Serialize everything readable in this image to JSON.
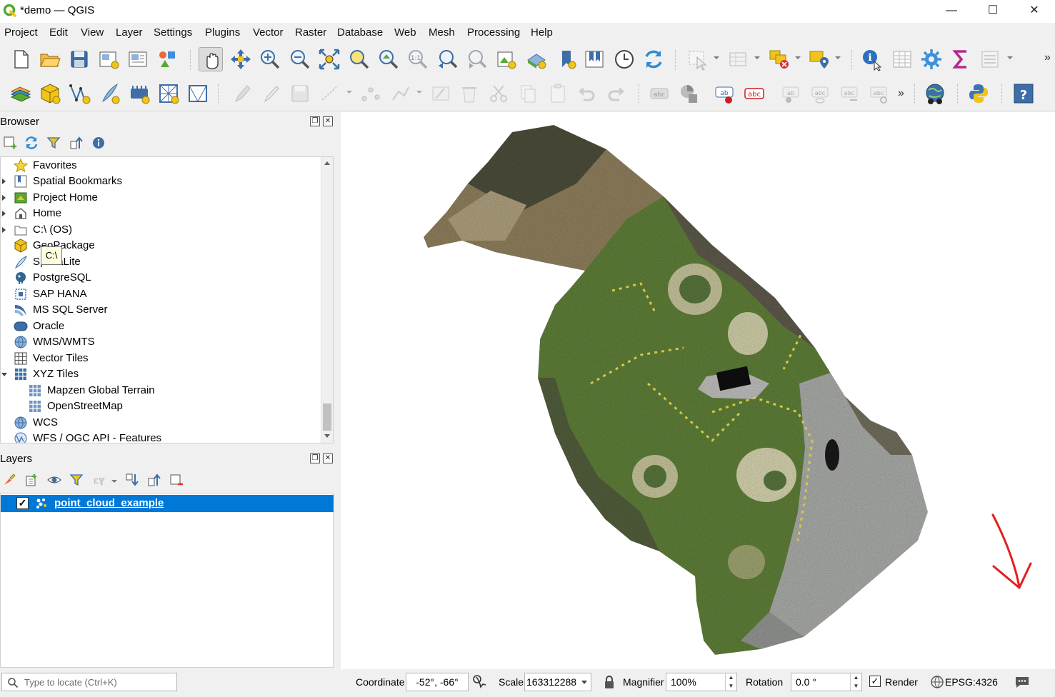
{
  "window": {
    "title": "*demo — QGIS",
    "minimize": "—",
    "maximize": "☐",
    "close": "✕"
  },
  "menu": [
    "Project",
    "Edit",
    "View",
    "Layer",
    "Settings",
    "Plugins",
    "Vector",
    "Raster",
    "Database",
    "Web",
    "Mesh",
    "Processing",
    "Help"
  ],
  "toolbar": {
    "overflow": "»"
  },
  "browser": {
    "title": "Browser",
    "float_btn": "❐",
    "close_btn": "✕",
    "items": [
      {
        "label": "Favorites",
        "icon": "star-icon"
      },
      {
        "label": "Spatial Bookmarks",
        "icon": "bookmark-icon"
      },
      {
        "label": "Project Home",
        "icon": "project-home-icon"
      },
      {
        "label": "Home",
        "icon": "home-icon"
      },
      {
        "label": "C:\\ (OS)",
        "icon": "drive-folder-icon"
      },
      {
        "label": "GeoPackage",
        "icon": "geopackage-icon"
      },
      {
        "label": "SpatiaLite",
        "icon": "spatialite-icon"
      },
      {
        "label": "PostgreSQL",
        "icon": "postgresql-icon"
      },
      {
        "label": "SAP HANA",
        "icon": "sap-hana-icon"
      },
      {
        "label": "MS SQL Server",
        "icon": "mssql-icon"
      },
      {
        "label": "Oracle",
        "icon": "oracle-icon"
      },
      {
        "label": "WMS/WMTS",
        "icon": "wms-icon"
      },
      {
        "label": "Vector Tiles",
        "icon": "vector-tiles-icon"
      },
      {
        "label": "XYZ Tiles",
        "icon": "xyz-tiles-icon"
      },
      {
        "label": "Mapzen Global Terrain",
        "icon": "xyz-tile-icon"
      },
      {
        "label": "OpenStreetMap",
        "icon": "xyz-tile-icon"
      },
      {
        "label": "WCS",
        "icon": "wcs-icon"
      },
      {
        "label": "WFS / OGC API - Features",
        "icon": "wfs-icon"
      }
    ],
    "tooltip": "C:\\"
  },
  "layers": {
    "title": "Layers",
    "float_btn": "❐",
    "close_btn": "✕",
    "items": [
      {
        "name": "point_cloud_example",
        "checked": "✓",
        "icon": "point-cloud-icon"
      }
    ]
  },
  "statusbar": {
    "locator_placeholder": "Type to locate (Ctrl+K)",
    "coordinate_label": "Coordinate",
    "coordinate_value": "-52°, -66°",
    "scale_label": "Scale",
    "scale_value": "163312288",
    "magnifier_label": "Magnifier",
    "magnifier_value": "100%",
    "rotation_label": "Rotation",
    "rotation_value": "0.0 °",
    "render_label": "Render",
    "render_checked": "✓",
    "crs": "EPSG:4326"
  },
  "colors": {
    "selection": "#0078d7",
    "annotation_arrow": "#e0201e",
    "grass": "#5b7a36",
    "pavement": "#a3a5a2"
  }
}
